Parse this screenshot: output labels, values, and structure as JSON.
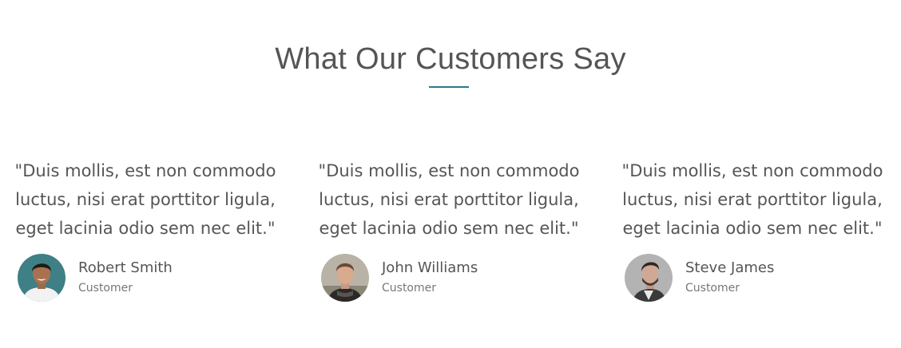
{
  "section": {
    "title": "What Our Customers Say",
    "accent_color": "#2a7a8c"
  },
  "testimonials": [
    {
      "quote": "\"Duis mollis, est non commodo luctus, nisi erat porttitor ligula, eget lacinia odio sem nec elit.\"",
      "name": "Robert Smith",
      "role": "Customer",
      "avatar_icon": "person-avatar-icon"
    },
    {
      "quote": "\"Duis mollis, est non commodo luctus, nisi erat porttitor ligula, eget lacinia odio sem nec elit.\"",
      "name": "John Williams",
      "role": "Customer",
      "avatar_icon": "person-avatar-icon"
    },
    {
      "quote": "\"Duis mollis, est non commodo luctus, nisi erat porttitor ligula, eget lacinia odio sem nec elit.\"",
      "name": "Steve James",
      "role": "Customer",
      "avatar_icon": "person-avatar-icon"
    }
  ]
}
